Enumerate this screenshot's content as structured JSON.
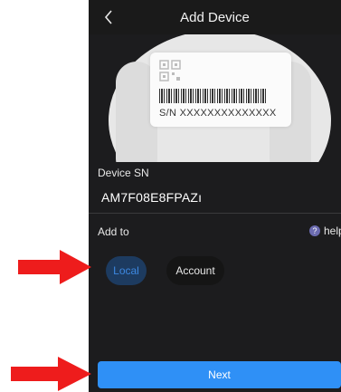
{
  "header": {
    "back_icon": "chevron-left-icon",
    "title": "Add Device"
  },
  "hero": {
    "sn_label_text": "S/N  XXXXXXXXXXXXXX"
  },
  "device_sn": {
    "label": "Device SN",
    "value": "AM7F08E8FPAZı"
  },
  "add_to": {
    "label": "Add to",
    "help_icon": "question-circle-icon",
    "help_text": "help",
    "options": [
      {
        "label": "Local",
        "selected": true
      },
      {
        "label": "Account",
        "selected": false
      }
    ]
  },
  "footer": {
    "next_label": "Next"
  },
  "annotations": {
    "arrow_color": "#ee1c1c",
    "arrow_icon": "red-arrow-right-icon"
  },
  "colors": {
    "screen_bg": "#1c1c1e",
    "primary": "#2f90f6",
    "selected_pill_bg": "#1d3b60",
    "selected_pill_text": "#3d88e0"
  }
}
